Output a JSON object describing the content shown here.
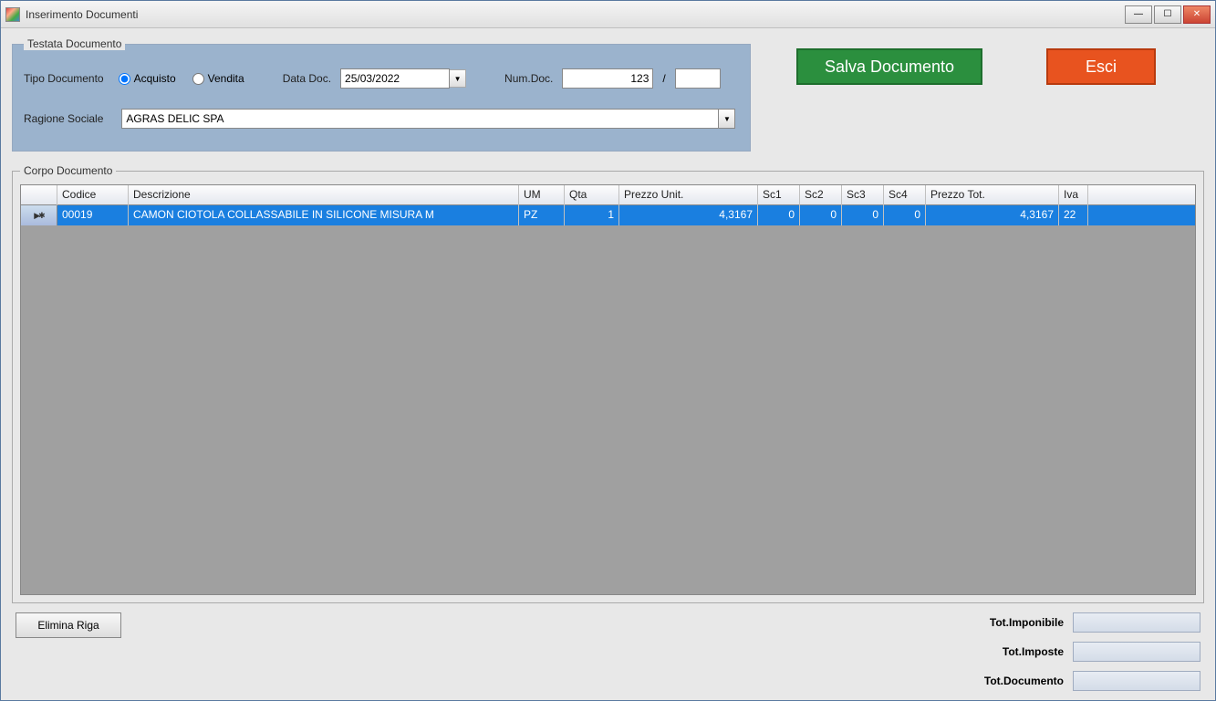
{
  "window": {
    "title": "Inserimento Documenti"
  },
  "buttons": {
    "save": "Salva Documento",
    "exit": "Esci",
    "delete_row": "Elimina Riga"
  },
  "header": {
    "legend": "Testata Documento",
    "tipo_label": "Tipo Documento",
    "radio_acquisto": "Acquisto",
    "radio_vendita": "Vendita",
    "tipo_selected": "Acquisto",
    "data_label": "Data Doc.",
    "data_value": "25/03/2022",
    "num_label": "Num.Doc.",
    "num_value": "123",
    "num_slash": "/",
    "num_suffix": "",
    "ragione_label": "Ragione Sociale",
    "ragione_value": "AGRAS DELIC SPA"
  },
  "body": {
    "legend": "Corpo Documento",
    "columns": {
      "codice": "Codice",
      "descrizione": "Descrizione",
      "um": "UM",
      "qta": "Qta",
      "prezzo_unit": "Prezzo Unit.",
      "sc1": "Sc1",
      "sc2": "Sc2",
      "sc3": "Sc3",
      "sc4": "Sc4",
      "prezzo_tot": "Prezzo Tot.",
      "iva": "Iva"
    },
    "rows": [
      {
        "codice": "00019",
        "descrizione": "CAMON CIOTOLA COLLASSABILE IN SILICONE MISURA M",
        "um": "PZ",
        "qta": "1",
        "prezzo_unit": "4,3167",
        "sc1": "0",
        "sc2": "0",
        "sc3": "0",
        "sc4": "0",
        "prezzo_tot": "4,3167",
        "iva": "22"
      }
    ]
  },
  "totals": {
    "imponibile_label": "Tot.Imponibile",
    "imponibile_value": "",
    "imposte_label": "Tot.Imposte",
    "imposte_value": "",
    "documento_label": "Tot.Documento",
    "documento_value": ""
  }
}
